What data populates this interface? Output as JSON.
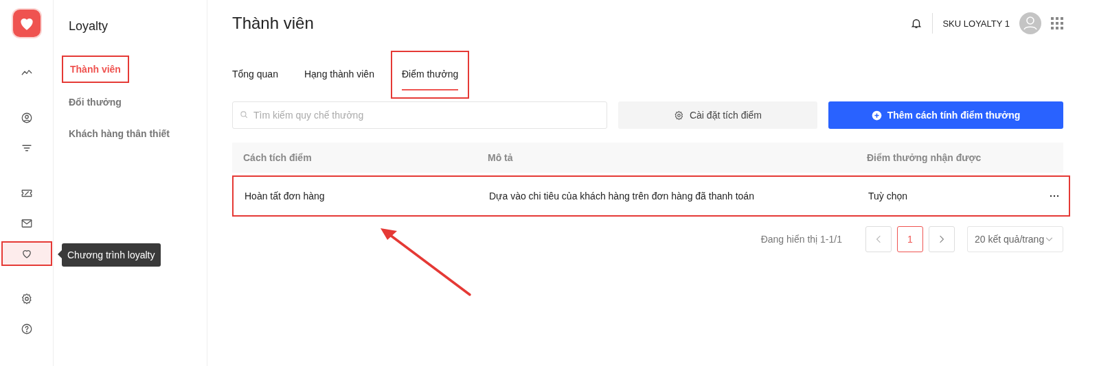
{
  "rail": {
    "items": [
      {
        "selected": false,
        "annotated": false
      },
      {
        "selected": false,
        "annotated": false
      },
      {
        "selected": false,
        "annotated": false
      },
      {
        "selected": false,
        "annotated": false
      },
      {
        "selected": false,
        "annotated": false
      },
      {
        "selected": true,
        "annotated": true
      },
      {
        "selected": false,
        "annotated": false
      },
      {
        "selected": false,
        "annotated": false
      }
    ],
    "tooltip": "Chương trình loyalty"
  },
  "subnav": {
    "title": "Loyalty",
    "items": [
      {
        "label": "Thành viên",
        "selected": true,
        "annotated": true
      },
      {
        "label": "Đổi thưởng",
        "selected": false,
        "annotated": false
      },
      {
        "label": "Khách hàng thân thiết",
        "selected": false,
        "annotated": false
      }
    ]
  },
  "header": {
    "title": "Thành viên",
    "account": "SKU LOYALTY 1"
  },
  "tabs": [
    {
      "label": "Tổng quan",
      "selected": false,
      "annotated": false
    },
    {
      "label": "Hạng thành viên",
      "selected": false,
      "annotated": false
    },
    {
      "label": "Điểm thưởng",
      "selected": true,
      "annotated": true
    }
  ],
  "search": {
    "placeholder": "Tìm kiếm quy chế thưởng"
  },
  "buttons": [
    {
      "kind": "secondary",
      "label": "Cài đặt tích điểm"
    },
    {
      "kind": "primary",
      "label": "Thêm cách tính điểm thưởng"
    }
  ],
  "table": {
    "columns": [
      "Cách tích điểm",
      "Mô tả",
      "Điểm thưởng nhận được"
    ],
    "rows": [
      {
        "cells": [
          "Hoàn tất đơn hàng",
          "Dựa vào chi tiêu của khách hàng trên đơn hàng đã thanh toán",
          "Tuỳ chọn"
        ],
        "annotated": true
      }
    ]
  },
  "pagination": {
    "summary": "Đang hiển thị 1-1/1",
    "pages": [
      {
        "label": "1",
        "selected": true
      }
    ],
    "page_size": "20 kết quả/trang"
  }
}
